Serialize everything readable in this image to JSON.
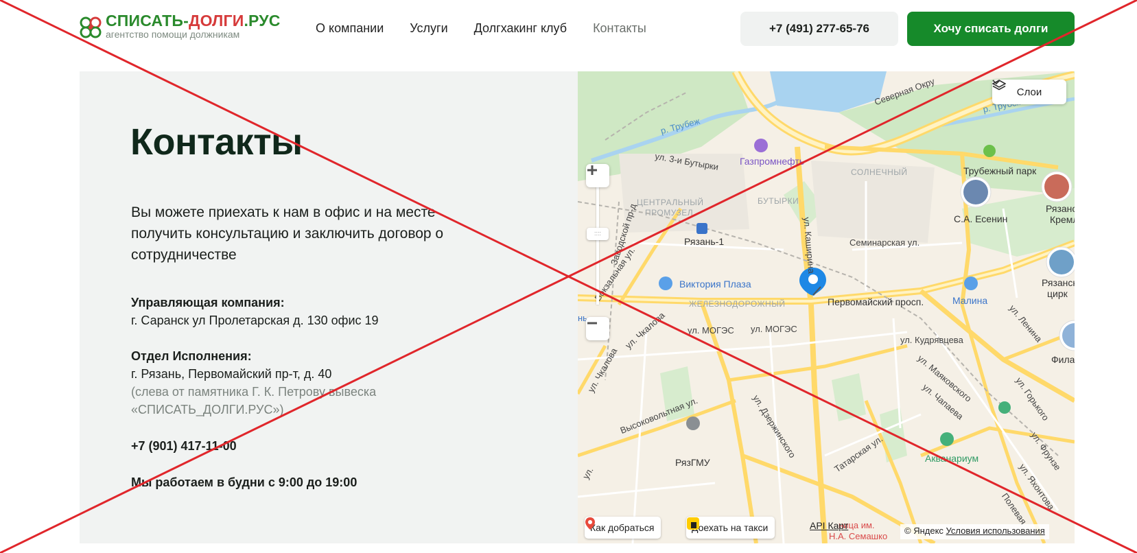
{
  "header": {
    "logo_title_part1": "СПИСАТЬ-",
    "logo_title_part2": "ДОЛГИ",
    "logo_title_part3": ".РУС",
    "logo_subtitle": "агентство помощи должникам",
    "nav": [
      {
        "label": "О компании"
      },
      {
        "label": "Услуги"
      },
      {
        "label": "Долгхакинг клуб"
      },
      {
        "label": "Контакты"
      }
    ],
    "phone": "+7 (491) 277-65-76",
    "cta": "Хочу списать долги"
  },
  "contacts": {
    "title": "Контакты",
    "lead": "Вы можете приехать к нам в офис и на месте получить консультацию и заключить договор о сотрудничестве",
    "management_label": "Управляющая компания:",
    "management_address": "г. Саранск ул Пролетарская д. 130 офис 19",
    "execution_label": "Отдел Исполнения:",
    "execution_address": "г. Рязань, Первомайский пр-т, д. 40",
    "execution_note_1": "(слева от памятника Г. К. Петрову вывеска",
    "execution_note_2": "«СПИСАТЬ_ДОЛГИ.РУС»)",
    "phone": "+7 (901) 417-11-00",
    "hours": "Мы работаем в будни с 9:00 до 19:00"
  },
  "map": {
    "layers_label": "Слои",
    "route_label": "Как добраться",
    "taxi_label": "Доехать на такси",
    "api_label": "API Карт",
    "copyright_prefix": "© Яндекс",
    "terms_label": "Условия использования",
    "labels": {
      "severnaya": "Северная Окру",
      "trubezh1": "р. Трубеж",
      "trubezh2": "р. Трубеж",
      "butyrki3": "ул. 3-и Бутырки",
      "gazpromneft": "Газпромнефть",
      "solnechny": "СОЛНЕЧНЫЙ",
      "trubezhny_park": "Трубежный парк",
      "central_1": "ЦЕНТРАЛЬНЫЙ",
      "central_2": "ПРОМУЗЕЛ",
      "butyrki": "БУТЫРКИ",
      "esenin": "С.А. Есенин",
      "ryazan_kreml_1": "Рязански",
      "ryazan_kreml_2": "Кремль",
      "kashirina": "ул. Каширина",
      "ryazan1": "Рязань-1",
      "seminarskaya": "Семинарская ул.",
      "zavodskoy": "Заводской пр-д",
      "vokzalnaya": "Вокзальная ул.",
      "victoria": "Виктория Плаза",
      "zheleznodorozhny": "ЖЕЛЕЗНОДОРОЖНЫЙ",
      "pervomaisky": "Первомайский просп.",
      "malina": "Малина",
      "circus_1": "Рязанск",
      "circus_2": "цирк",
      "chkalova1": "ул. Чкалова",
      "mogez1": "ул. МОГЭС",
      "mogez2": "ул. МОГЭС",
      "lenina": "ул. Ленина",
      "kudryavceva": "ул. Кудрявцева",
      "fila": "Фила",
      "chkalova2": "ул. Чкалова",
      "mayakovskogo": "ул. Маяковского",
      "chapaeva": "ул. Чапаева",
      "gorkogo": "ул. Горького",
      "vysokovoltnaya": "Высоковольтная ул.",
      "dzerzhinskogo": "ул. Дзержинского",
      "ryazgmu": "РязГМУ",
      "tatarskaya": "Татарская ул.",
      "frunze": "ул. Фрунзе",
      "aquanarium": "Акванариум",
      "yakhontova": "ул. Яхонтова",
      "polevaya": "Полевая",
      "semashko_1": "ница им.",
      "semashko_2": "Н.А. Семашко",
      "ul_small": "ул.",
      "nh": "нь"
    }
  },
  "colors": {
    "brand_green": "#168a2a",
    "logo_red": "#d63a3a",
    "cross_red": "#e0262b",
    "panel_bg": "#f1f3f2",
    "marker_blue": "#1e88e5"
  }
}
